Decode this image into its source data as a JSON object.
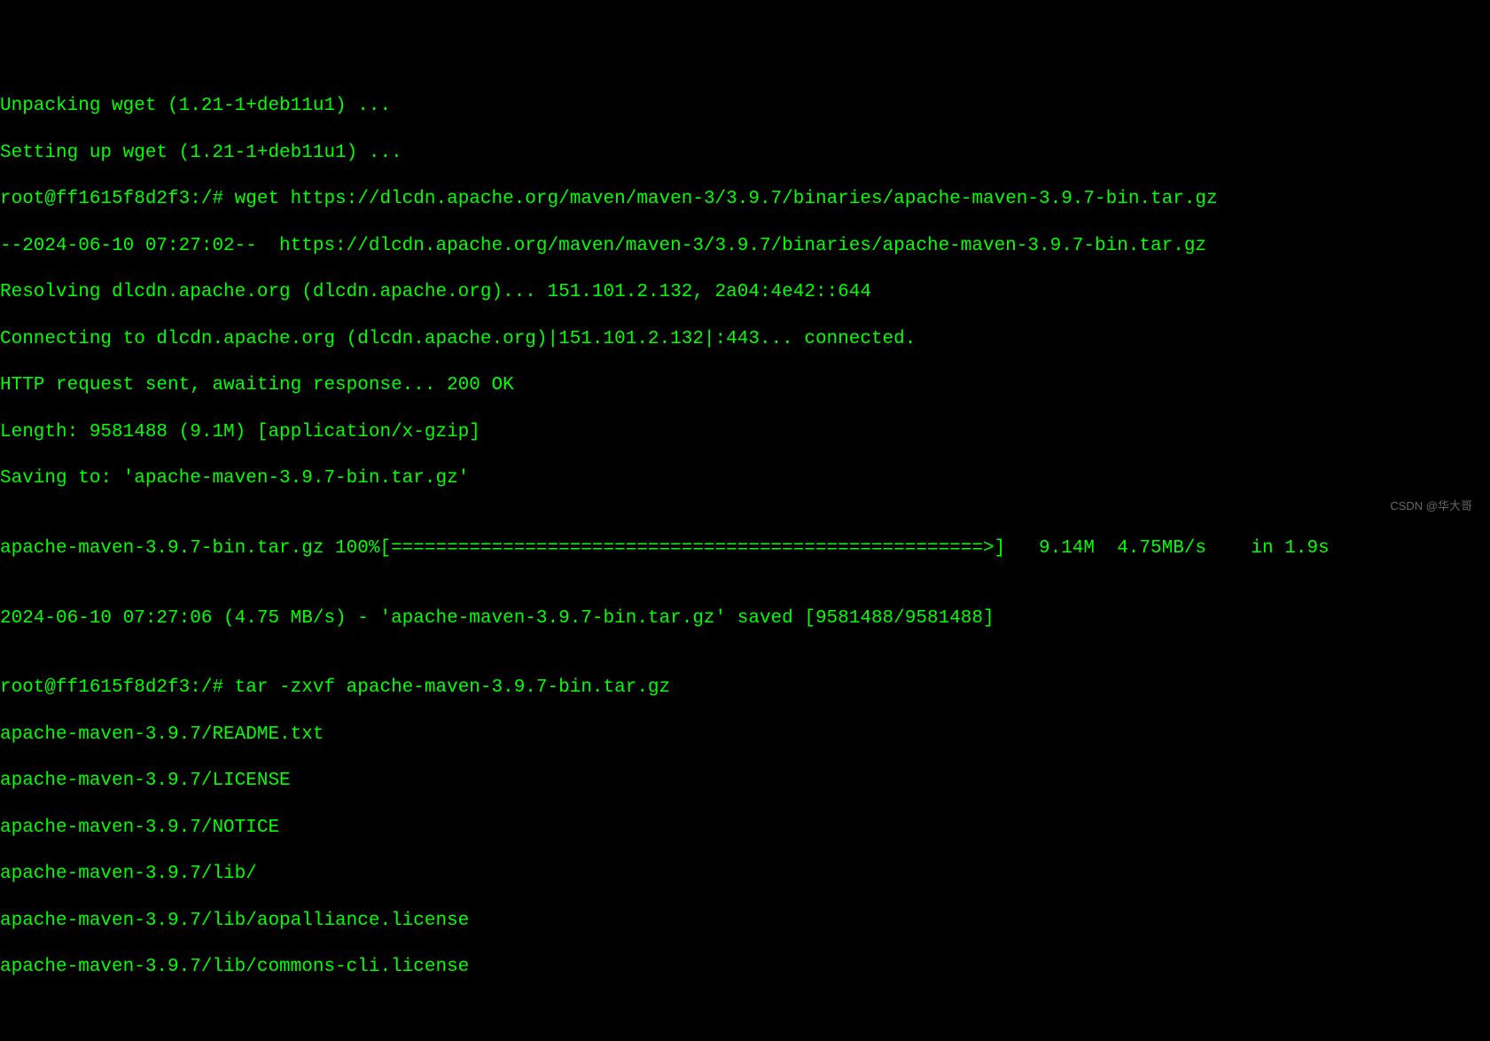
{
  "terminal": {
    "lines": {
      "l0": "Unpacking wget (1.21-1+deb11u1) ...",
      "l1": "Setting up wget (1.21-1+deb11u1) ...",
      "l2_prompt": "root@ff1615f8d2f3:/# ",
      "l2_cmd": "wget https://dlcdn.apache.org/maven/maven-3/3.9.7/binaries/apache-maven-3.9.7-bin.tar.gz",
      "l3": "--2024-06-10 07:27:02--  https://dlcdn.apache.org/maven/maven-3/3.9.7/binaries/apache-maven-3.9.7-bin.tar.gz",
      "l4": "Resolving dlcdn.apache.org (dlcdn.apache.org)... 151.101.2.132, 2a04:4e42::644",
      "l5": "Connecting to dlcdn.apache.org (dlcdn.apache.org)|151.101.2.132|:443... connected.",
      "l6": "HTTP request sent, awaiting response... 200 OK",
      "l7": "Length: 9581488 (9.1M) [application/x-gzip]",
      "l8": "Saving to: 'apache-maven-3.9.7-bin.tar.gz'",
      "l9": "",
      "l10": "apache-maven-3.9.7-bin.tar.gz 100%[=====================================================>]   9.14M  4.75MB/s    in 1.9s",
      "l11": "",
      "l12": "2024-06-10 07:27:06 (4.75 MB/s) - 'apache-maven-3.9.7-bin.tar.gz' saved [9581488/9581488]",
      "l13": "",
      "l14_prompt": "root@ff1615f8d2f3:/# ",
      "l14_cmd": "tar -zxvf apache-maven-3.9.7-bin.tar.gz",
      "l15": "apache-maven-3.9.7/README.txt",
      "l16": "apache-maven-3.9.7/LICENSE",
      "l17": "apache-maven-3.9.7/NOTICE",
      "l18": "apache-maven-3.9.7/lib/",
      "l19": "apache-maven-3.9.7/lib/aopalliance.license",
      "l20": "apache-maven-3.9.7/lib/commons-cli.license"
    }
  },
  "watermark": "CSDN @华大哥"
}
